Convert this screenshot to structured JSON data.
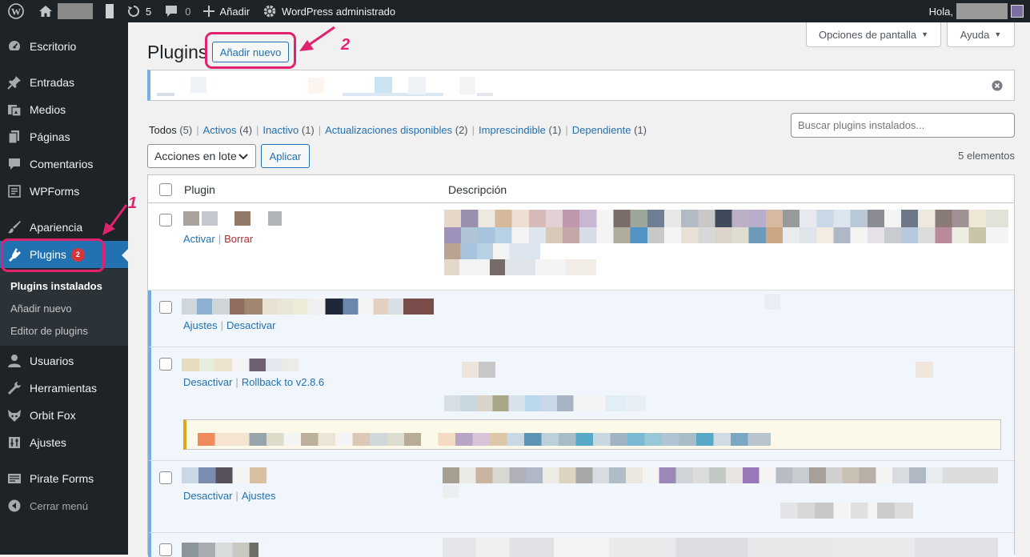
{
  "adminbar": {
    "comments_count": "0",
    "updates_count": "5",
    "add_new": "Añadir",
    "managed": "WordPress administrado",
    "greeting": "Hola, "
  },
  "sidebar": {
    "items": [
      {
        "label": "Escritorio",
        "icon": "dashboard-icon"
      },
      {
        "label": "Entradas",
        "icon": "pin-icon"
      },
      {
        "label": "Medios",
        "icon": "media-icon"
      },
      {
        "label": "Páginas",
        "icon": "pages-icon"
      },
      {
        "label": "Comentarios",
        "icon": "comments-icon"
      },
      {
        "label": "WPForms",
        "icon": "forms-icon"
      },
      {
        "label": "Apariencia",
        "icon": "brush-icon"
      },
      {
        "label": "Plugins",
        "icon": "plugin-icon",
        "badge": "2"
      },
      {
        "label": "Usuarios",
        "icon": "users-icon"
      },
      {
        "label": "Herramientas",
        "icon": "tools-icon"
      },
      {
        "label": "Orbit Fox",
        "icon": "fox-icon"
      },
      {
        "label": "Ajustes",
        "icon": "settings-icon"
      },
      {
        "label": "Pirate Forms",
        "icon": "pirate-forms-icon"
      },
      {
        "label": "Cerrar menú",
        "icon": "collapse-icon"
      }
    ],
    "submenu": [
      "Plugins instalados",
      "Añadir nuevo",
      "Editor de plugins"
    ]
  },
  "annotations": {
    "one": "1",
    "two": "2",
    "color": "#e0226f"
  },
  "page": {
    "title": "Plugins",
    "add_new_button": "Añadir nuevo",
    "screen_options": "Opciones de pantalla",
    "help": "Ayuda"
  },
  "filters": {
    "all": "Todos",
    "all_count": "(5)",
    "active": "Activos",
    "active_count": "(4)",
    "inactive": "Inactivo",
    "inactive_count": "(1)",
    "updates": "Actualizaciones disponibles",
    "updates_count": "(2)",
    "mustuse": "Imprescindible",
    "mustuse_count": "(1)",
    "dropins": "Dependiente",
    "dropins_count": "(1)"
  },
  "search": {
    "placeholder": "Buscar plugins instalados..."
  },
  "bulk": {
    "select": "Acciones en lote",
    "apply": "Aplicar"
  },
  "items_count": "5 elementos",
  "table": {
    "col_plugin": "Plugin",
    "col_description": "Descripción",
    "rows": [
      {
        "a1": "Activar",
        "a2": "Borrar"
      },
      {
        "a1": "Ajustes",
        "a2": "Desactivar"
      },
      {
        "a1": "Desactivar",
        "a2": "Rollback to v2.8.6"
      },
      {
        "a1": "Desactivar",
        "a2": "Ajustes"
      }
    ]
  },
  "colors": {
    "accent": "#2271b1",
    "sidebar": "#1d2327",
    "active_row": "#f0f6fc",
    "delete": "#b32d2e"
  }
}
